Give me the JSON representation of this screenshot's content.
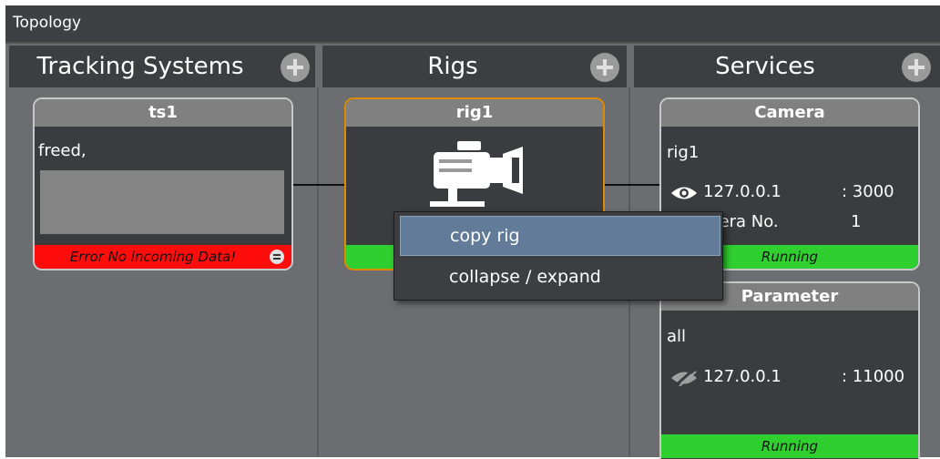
{
  "window": {
    "title": "Topology"
  },
  "columns": [
    {
      "label": "Tracking Systems"
    },
    {
      "label": "Rigs"
    },
    {
      "label": "Services"
    }
  ],
  "ts_card": {
    "title": "ts1",
    "text": "freed,",
    "status": "Error No incoming Data!"
  },
  "rig_card": {
    "title": "rig1"
  },
  "camera_card": {
    "title": "Camera",
    "rig": "rig1",
    "ip": "127.0.0.1",
    "port": ": 3000",
    "cam_label": "mera No.",
    "cam_value": "1",
    "status": "Running"
  },
  "parameter_card": {
    "title": "Parameter",
    "scope": "all",
    "ip": "127.0.0.1",
    "port": ": 11000",
    "status": "Running"
  },
  "context_menu": {
    "items": [
      "copy rig",
      "collapse / expand"
    ]
  },
  "colors": {
    "running": "#2fcf2f",
    "error": "#ff0c0c",
    "selected_border": "#e08a00",
    "menu_highlight": "#627b99"
  }
}
